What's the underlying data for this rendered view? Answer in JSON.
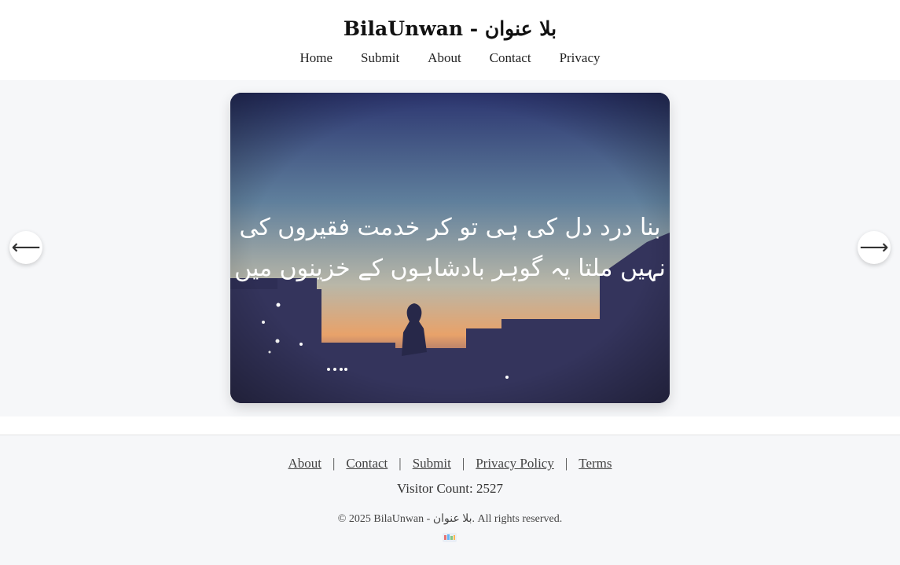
{
  "header": {
    "title": "BilaUnwan - بلا عنوان",
    "nav": [
      "Home",
      "Submit",
      "About",
      "Contact",
      "Privacy"
    ]
  },
  "slider": {
    "prev_label": "⟵",
    "next_label": "⟶",
    "poem_lines": [
      "بنا درد دل کی ہی تو کر خدمت فقیروں کی",
      "نہیں ملتا یہ گوہر بادشاہوں کے خزینوں میں"
    ]
  },
  "footer": {
    "links": [
      "About",
      "Contact",
      "Submit",
      "Privacy Policy",
      "Terms"
    ],
    "separator": "|",
    "visitor_count": "Visitor Count: 2527",
    "copyright": "© 2025 BilaUnwan - بلا عنوان. All rights reserved."
  }
}
